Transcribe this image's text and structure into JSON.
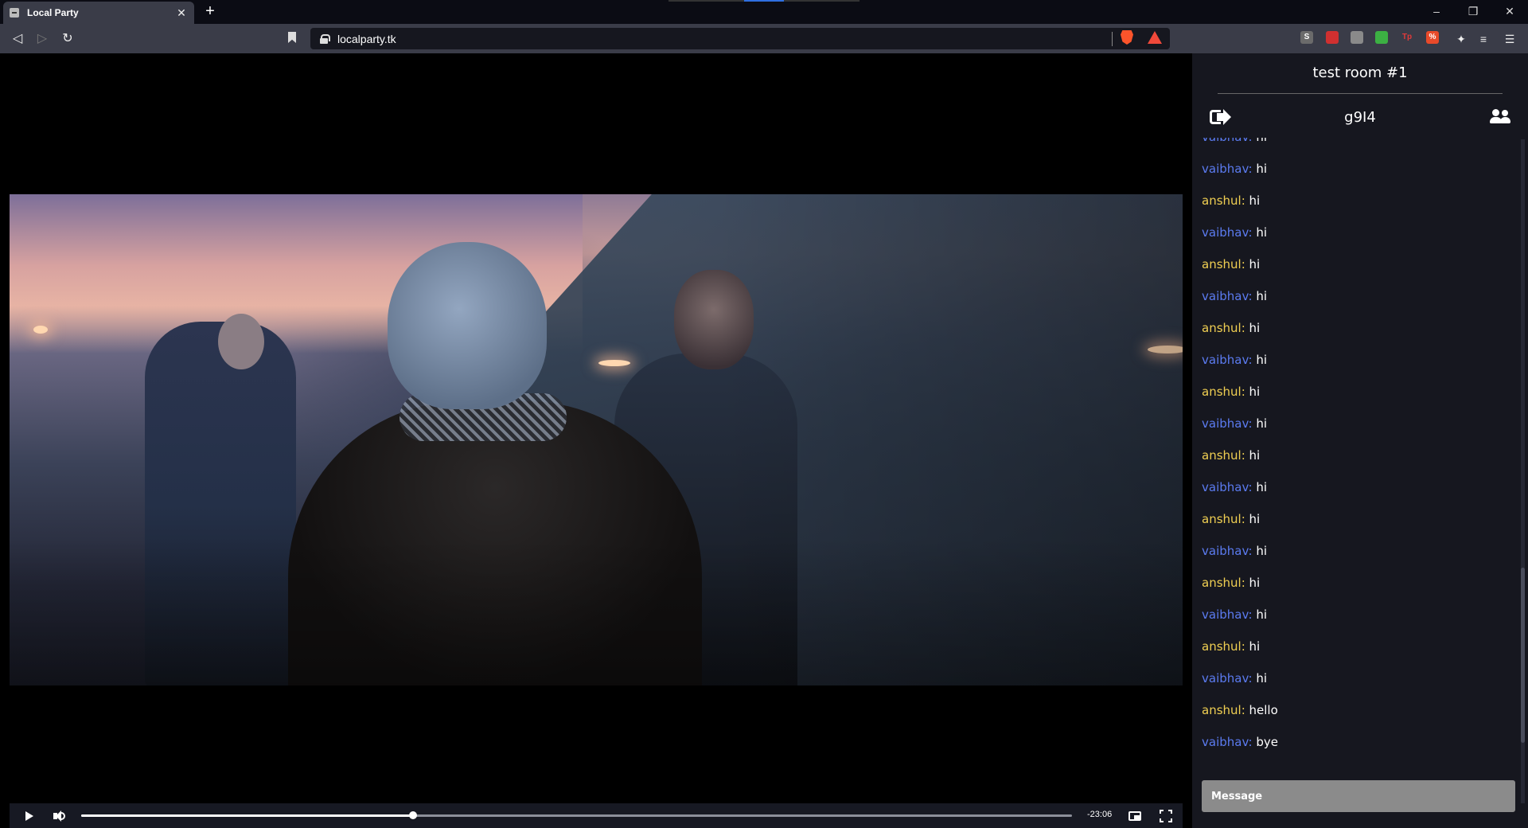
{
  "browser": {
    "tab_title": "Local Party",
    "tab_close": "✕",
    "new_tab": "+",
    "url": "localparty.tk",
    "window": {
      "minimize": "–",
      "restore": "❐",
      "close": "✕"
    },
    "extensions": [
      {
        "name": "s-extension-icon",
        "label": "S",
        "color": "#6b6b6b"
      },
      {
        "name": "ublock-icon",
        "label": "",
        "color": "#d03030"
      },
      {
        "name": "circle-extension-icon",
        "label": "",
        "color": "#8a8a8a"
      },
      {
        "name": "color-picker-icon",
        "label": "",
        "color": "#3cb043"
      },
      {
        "name": "tp-extension-icon",
        "label": "Tp",
        "color": "transparent"
      },
      {
        "name": "percent-extension-icon",
        "label": "%",
        "color": "#e84a2a"
      }
    ]
  },
  "video": {
    "time_remaining": "-23:06",
    "progress": 0.335
  },
  "chat": {
    "room_name": "test room #1",
    "room_code": "g9I4",
    "input_placeholder": "Message",
    "messages": [
      {
        "user": "vaibhav:",
        "text": "hi",
        "color": "blue"
      },
      {
        "user": "vaibhav:",
        "text": "hi",
        "color": "blue"
      },
      {
        "user": "anshul:",
        "text": "hi",
        "color": "gold"
      },
      {
        "user": "vaibhav:",
        "text": "hi",
        "color": "blue"
      },
      {
        "user": "anshul:",
        "text": "hi",
        "color": "gold"
      },
      {
        "user": "vaibhav:",
        "text": "hi",
        "color": "blue"
      },
      {
        "user": "anshul:",
        "text": "hi",
        "color": "gold"
      },
      {
        "user": "vaibhav:",
        "text": "hi",
        "color": "blue"
      },
      {
        "user": "anshul:",
        "text": "hi",
        "color": "gold"
      },
      {
        "user": "vaibhav:",
        "text": "hi",
        "color": "blue"
      },
      {
        "user": "anshul:",
        "text": "hi",
        "color": "gold"
      },
      {
        "user": "vaibhav:",
        "text": "hi",
        "color": "blue"
      },
      {
        "user": "anshul:",
        "text": "hi",
        "color": "gold"
      },
      {
        "user": "vaibhav:",
        "text": "hi",
        "color": "blue"
      },
      {
        "user": "anshul:",
        "text": "hi",
        "color": "gold"
      },
      {
        "user": "vaibhav:",
        "text": "hi",
        "color": "blue"
      },
      {
        "user": "anshul:",
        "text": "hi",
        "color": "gold"
      },
      {
        "user": "vaibhav:",
        "text": "hi",
        "color": "blue"
      },
      {
        "user": "anshul:",
        "text": "hello",
        "color": "gold"
      },
      {
        "user": "vaibhav:",
        "text": "bye",
        "color": "blue"
      }
    ]
  }
}
